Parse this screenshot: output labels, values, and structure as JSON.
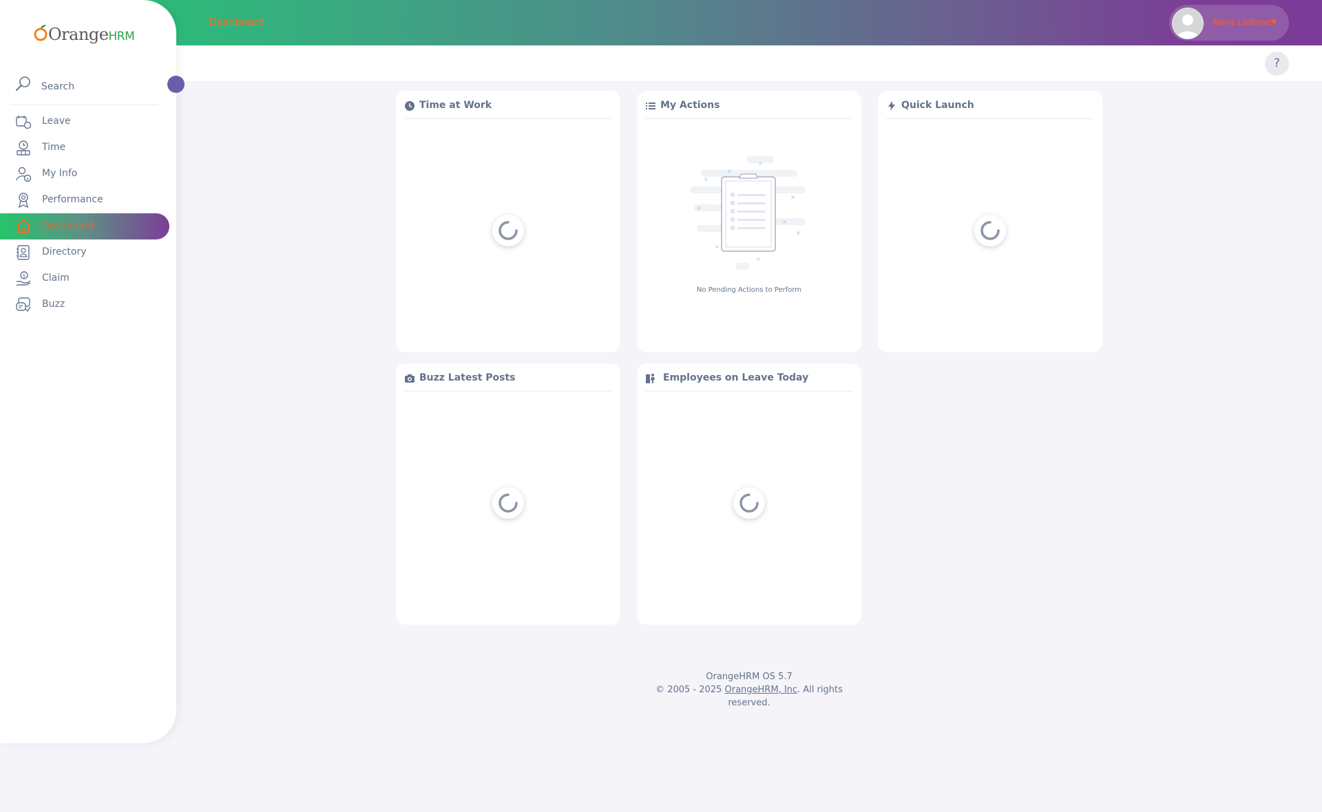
{
  "header": {
    "breadcrumb": "Dashboard",
    "user_name": "Alana Ludlowe",
    "user_menu_icon": "caret-down-icon"
  },
  "subheader": {
    "help_label": "?"
  },
  "brand": {
    "logo_main": "Orange",
    "logo_suffix": "HRM"
  },
  "sidebar": {
    "search_placeholder": "Search",
    "items": [
      {
        "label": "Leave",
        "icon": "leave-icon"
      },
      {
        "label": "Time",
        "icon": "time-icon"
      },
      {
        "label": "My Info",
        "icon": "my-info-icon"
      },
      {
        "label": "Performance",
        "icon": "performance-icon"
      },
      {
        "label": "Dashboard",
        "icon": "home-icon",
        "active": true
      },
      {
        "label": "Directory",
        "icon": "directory-icon"
      },
      {
        "label": "Claim",
        "icon": "claim-icon"
      },
      {
        "label": "Buzz",
        "icon": "buzz-icon"
      }
    ]
  },
  "widgets": [
    {
      "title": "Time at Work",
      "icon": "clock-icon",
      "state": "loading"
    },
    {
      "title": "My Actions",
      "icon": "list-icon",
      "state": "empty",
      "empty_message": "No Pending Actions to Perform"
    },
    {
      "title": "Quick Launch",
      "icon": "lightning-icon",
      "state": "loading"
    },
    {
      "title": "Buzz Latest Posts",
      "icon": "camera-icon",
      "state": "loading"
    },
    {
      "title": "Employees on Leave Today",
      "icon": "person-leave-icon",
      "state": "loading"
    }
  ],
  "footer": {
    "version": "OrangeHRM OS 5.7",
    "copyright_prefix": "© 2005 - 2025 ",
    "company_link": "OrangeHRM, Inc",
    "copyright_suffix": ". All rights reserved."
  },
  "colors": {
    "accent": "#ff5a26",
    "gradient_start": "#27c46b",
    "gradient_end": "#7b3e97",
    "text": "#64728c",
    "background": "#f4f4f9"
  }
}
